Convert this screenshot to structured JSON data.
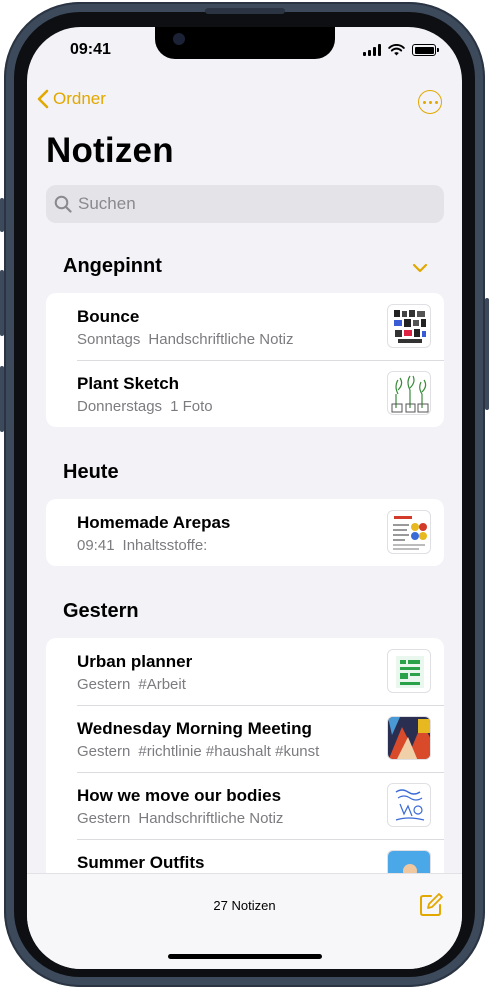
{
  "status": {
    "time": "09:41"
  },
  "nav": {
    "back_label": "Ordner"
  },
  "page": {
    "title": "Notizen"
  },
  "search": {
    "placeholder": "Suchen"
  },
  "sections": {
    "pinned": {
      "title": "Angepinnt",
      "notes": [
        {
          "title": "Bounce",
          "date": "Sonntags",
          "preview": "Handschriftliche Notiz"
        },
        {
          "title": "Plant Sketch",
          "date": "Donnerstags",
          "preview": "1 Foto"
        }
      ]
    },
    "today": {
      "title": "Heute",
      "notes": [
        {
          "title": "Homemade Arepas",
          "date": "09:41",
          "preview": "Inhaltsstoffe:"
        }
      ]
    },
    "yesterday": {
      "title": "Gestern",
      "notes": [
        {
          "title": "Urban planner",
          "date": "Gestern",
          "preview": "#Arbeit"
        },
        {
          "title": "Wednesday Morning Meeting",
          "date": "Gestern",
          "preview": "#richtlinie #haushalt #kunst"
        },
        {
          "title": "How we move our bodies",
          "date": "Gestern",
          "preview": "Handschriftliche Notiz"
        },
        {
          "title": "Summer Outfits",
          "date": "",
          "preview": ""
        }
      ]
    }
  },
  "toolbar": {
    "count_label": "27 Notizen"
  },
  "colors": {
    "accent": "#e2a800",
    "background": "#f2f2f7",
    "secondary_text": "#7c7c80"
  }
}
